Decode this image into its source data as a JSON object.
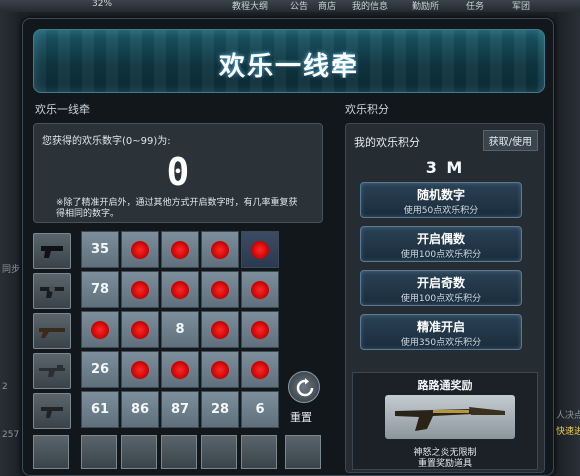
{
  "background": {
    "topbar": [
      "32%",
      "教程大纲",
      "公告",
      "商店",
      "我的信息",
      "勤励所",
      "任务",
      "军团"
    ],
    "left_labels": [
      "同步",
      "2",
      "257"
    ],
    "right_labels": [
      "人决点",
      "快速进"
    ]
  },
  "window": {
    "title": "欢乐一线牵"
  },
  "left_panel": {
    "section_label": "欢乐一线牵",
    "prompt": "您获得的欢乐数字(0~99)为:",
    "number": "0",
    "note": "※除了精准开启外，通过其他方式开启数字时，有几率重复获得相同的数字。",
    "reset_label": "重置",
    "grid": [
      [
        {
          "n": "35",
          "m": false
        },
        {
          "n": "",
          "m": true
        },
        {
          "n": "",
          "m": true
        },
        {
          "n": "",
          "m": true
        },
        {
          "n": "",
          "m": true
        }
      ],
      [
        {
          "n": "78",
          "m": false
        },
        {
          "n": "",
          "m": true
        },
        {
          "n": "",
          "m": true
        },
        {
          "n": "",
          "m": true
        },
        {
          "n": "",
          "m": true
        }
      ],
      [
        {
          "n": "",
          "m": true
        },
        {
          "n": "",
          "m": true
        },
        {
          "n": "8",
          "m": false
        },
        {
          "n": "",
          "m": true
        },
        {
          "n": "",
          "m": true
        }
      ],
      [
        {
          "n": "26",
          "m": false
        },
        {
          "n": "",
          "m": true
        },
        {
          "n": "",
          "m": true
        },
        {
          "n": "",
          "m": true
        },
        {
          "n": "",
          "m": true
        }
      ],
      [
        {
          "n": "61",
          "m": false
        },
        {
          "n": "86",
          "m": false
        },
        {
          "n": "87",
          "m": false
        },
        {
          "n": "28",
          "m": false
        },
        {
          "n": "6",
          "m": false
        }
      ]
    ]
  },
  "right_panel": {
    "section_label": "欢乐积分",
    "points_title": "我的欢乐积分",
    "points_link": "获取/使用",
    "points_value": "3 M",
    "buttons": [
      {
        "label": "随机数字",
        "cost": "使用50点欢乐积分"
      },
      {
        "label": "开启偶数",
        "cost": "使用100点欢乐积分"
      },
      {
        "label": "开启奇数",
        "cost": "使用100点欢乐积分"
      },
      {
        "label": "精准开启",
        "cost": "使用350点欢乐积分"
      }
    ],
    "reward": {
      "title": "路路通奖励",
      "name": "神怒之炎无限制",
      "button": "重置奖励道具"
    }
  },
  "colors": {
    "title_bg": "#0f3642",
    "cell": "#6f808c",
    "mark": "#e00000"
  }
}
